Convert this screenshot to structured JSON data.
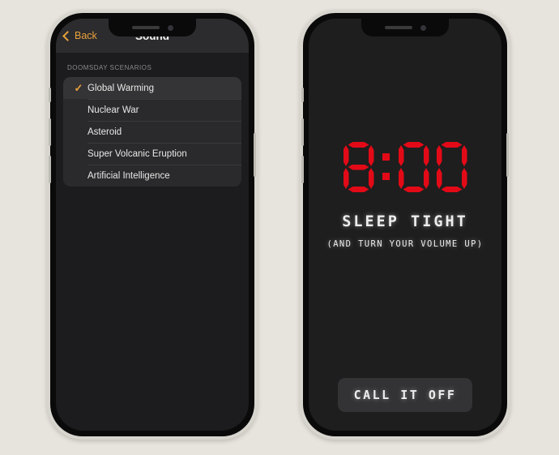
{
  "background_color": "#E7E4DD",
  "accent_color": "#E9A13B",
  "alarm_red": "#E30A17",
  "left_phone": {
    "nav": {
      "back_label": "Back",
      "back_icon": "chevron-left-icon",
      "title": "Sound"
    },
    "section_label": "DOOMSDAY SCENARIOS",
    "options": [
      {
        "label": "Global Warming",
        "selected": true,
        "check": "✓"
      },
      {
        "label": "Nuclear War",
        "selected": false,
        "check": ""
      },
      {
        "label": "Asteroid",
        "selected": false,
        "check": ""
      },
      {
        "label": "Super Volcanic Eruption",
        "selected": false,
        "check": ""
      },
      {
        "label": "Artificial  Intelligence",
        "selected": false,
        "check": ""
      }
    ]
  },
  "right_phone": {
    "clock": {
      "hours": "8",
      "separator": ":",
      "minutes": "00",
      "display_text": "8:00"
    },
    "headline": "SLEEP TIGHT",
    "subtext": "(AND TURN YOUR VOLUME UP)",
    "dismiss_button": "CALL IT OFF"
  }
}
